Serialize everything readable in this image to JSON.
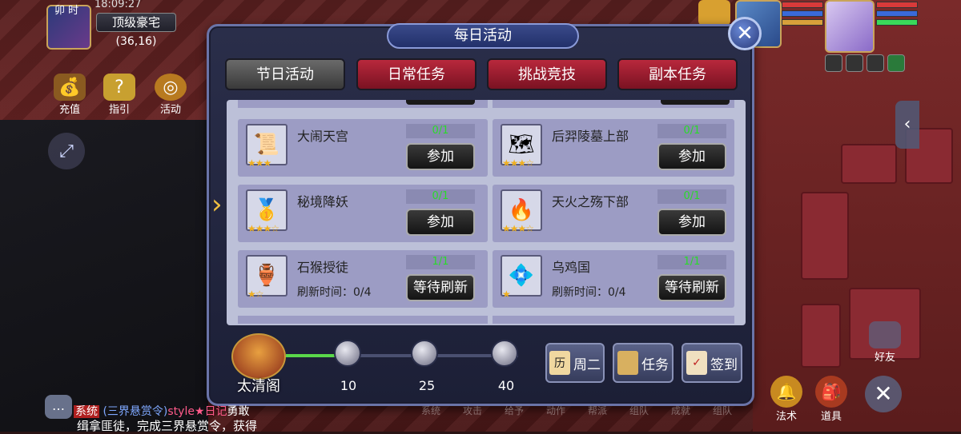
{
  "hud": {
    "time_label": "卯 时",
    "clock": "18:09:27",
    "map_name": "顶级豪宅",
    "coords": "(36,16)",
    "buttons": [
      {
        "label": "充值",
        "icon": "treasure-chest-icon"
      },
      {
        "label": "指引",
        "icon": "guide-scroll-icon"
      },
      {
        "label": "活动",
        "icon": "activity-icon"
      }
    ],
    "friend_label": "好友",
    "bottom_right": [
      {
        "label": "法术",
        "icon": "bell-icon"
      },
      {
        "label": "道具",
        "icon": "bag-icon"
      }
    ]
  },
  "chat": {
    "system_tag": "系统",
    "event_tag": "(三界悬赏令)",
    "style_text": "style★日记",
    "name_suffix": "勇敢",
    "line2": "缉拿匪徒，完成三界悬赏令，获得"
  },
  "bottom_menu": [
    "系统",
    "攻击",
    "给予",
    "动作",
    "帮派",
    "组队",
    "成就",
    "组队"
  ],
  "dialog": {
    "title": "每日活动",
    "tabs": [
      {
        "label": "节日活动",
        "state": "inactive"
      },
      {
        "label": "日常任务",
        "state": "active"
      },
      {
        "label": "挑战竞技",
        "state": "active"
      },
      {
        "label": "副本任务",
        "state": "active"
      }
    ],
    "activities": [
      {
        "name": "大闹天宫",
        "progress": "0/1",
        "button": "参加",
        "stars": 3,
        "max_stars": 3,
        "icon": "scroll-icon",
        "refresh": ""
      },
      {
        "name": "后羿陵墓上部",
        "progress": "0/1",
        "button": "参加",
        "stars": 3,
        "max_stars": 4,
        "icon": "map-icon",
        "refresh": ""
      },
      {
        "name": "秘境降妖",
        "progress": "0/1",
        "button": "参加",
        "stars": 3,
        "max_stars": 4,
        "icon": "gold-ingot-icon",
        "refresh": ""
      },
      {
        "name": "天火之殇下部",
        "progress": "0/1",
        "button": "参加",
        "stars": 3,
        "max_stars": 4,
        "icon": "fire-brazier-icon",
        "refresh": ""
      },
      {
        "name": "石猴授徒",
        "progress": "1/1",
        "button": "等待刷新",
        "stars": 1,
        "max_stars": 2,
        "icon": "gourd-icon",
        "refresh": "刷新时间：0/4"
      },
      {
        "name": "乌鸡国",
        "progress": "1/1",
        "button": "等待刷新",
        "stars": 1,
        "max_stars": 1,
        "icon": "jade-mirror-icon",
        "refresh": "刷新时间：0/4"
      }
    ],
    "pavilion_label": "太清阁",
    "milestones": [
      "10",
      "25",
      "40"
    ],
    "progress_fraction": 0.25,
    "actions": [
      {
        "label": "周二",
        "icon": "calendar-icon",
        "icon_text": "历"
      },
      {
        "label": "任务",
        "icon": "task-scroll-icon",
        "icon_text": ""
      },
      {
        "label": "签到",
        "icon": "sign-in-icon",
        "icon_text": ""
      }
    ]
  }
}
